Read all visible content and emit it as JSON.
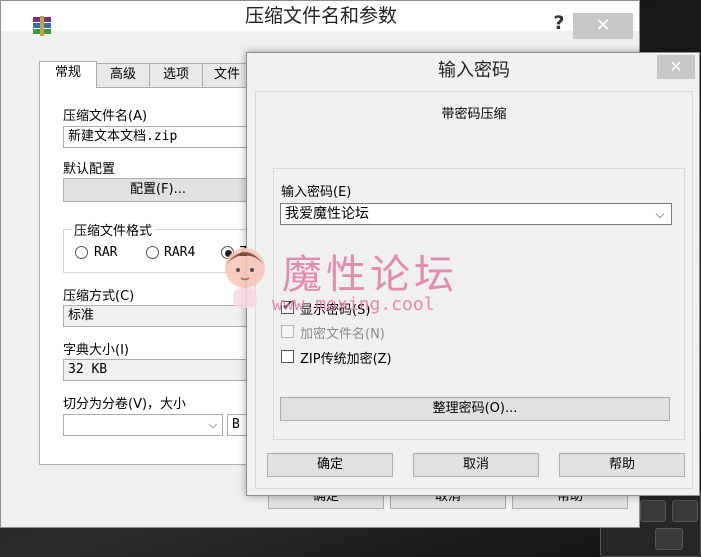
{
  "back_window": {
    "title": "压缩文件名和参数",
    "help_glyph": "?",
    "close_glyph": "✕",
    "tabs": [
      "常规",
      "高级",
      "选项",
      "文件"
    ],
    "archive_name_label": "压缩文件名(A)",
    "archive_name_value": "新建文本文档.zip",
    "default_profile_label": "默认配置",
    "profiles_button": "配置(F)...",
    "format_group_label": "压缩文件格式",
    "formats": [
      "RAR",
      "RAR4",
      "Z"
    ],
    "method_label": "压缩方式(C)",
    "method_value": "标准",
    "dict_label": "字典大小(I)",
    "dict_value": "32 KB",
    "split_label": "切分为分卷(V)，大小",
    "split_unit": "B",
    "bottom_buttons": [
      "确定",
      "取消",
      "帮助"
    ]
  },
  "dialog": {
    "title": "输入密码",
    "close_glyph": "✕",
    "subtitle": "带密码压缩",
    "password_label": "输入密码(E)",
    "password_value": "我爱魔性论坛",
    "show_password_label": "显示密码(S)",
    "show_password_checked": true,
    "encrypt_names_label": "加密文件名(N)",
    "encrypt_names_enabled": false,
    "zip_legacy_label": "ZIP传统加密(Z)",
    "zip_legacy_checked": false,
    "organize_button": "整理密码(O)...",
    "ok_button": "确定",
    "cancel_button": "取消",
    "help_button": "帮助"
  },
  "watermark": {
    "text": "魔性论坛",
    "url": "www.moxing.cool"
  }
}
